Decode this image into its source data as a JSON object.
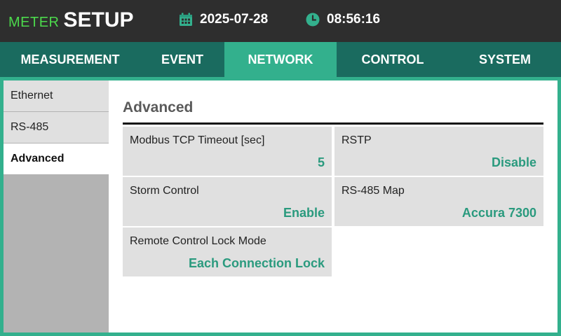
{
  "header": {
    "brand_meter": "METER",
    "brand_setup": "SETUP",
    "date": "2025-07-28",
    "time": "08:56:16",
    "icons": {
      "date": "calendar-icon",
      "time": "clock-icon"
    }
  },
  "tabs": [
    {
      "label": "MEASUREMENT",
      "active": false
    },
    {
      "label": "EVENT",
      "active": false
    },
    {
      "label": "NETWORK",
      "active": true
    },
    {
      "label": "CONTROL",
      "active": false
    },
    {
      "label": "SYSTEM",
      "active": false
    }
  ],
  "sidebar": {
    "items": [
      {
        "label": "Ethernet",
        "active": false
      },
      {
        "label": "RS-485",
        "active": false
      },
      {
        "label": "Advanced",
        "active": true
      }
    ]
  },
  "main": {
    "title": "Advanced",
    "settings": [
      {
        "label": "Modbus TCP Timeout [sec]",
        "value": "5"
      },
      {
        "label": "RSTP",
        "value": "Disable"
      },
      {
        "label": "Storm Control",
        "value": "Enable"
      },
      {
        "label": "RS-485 Map",
        "value": "Accura 7300"
      },
      {
        "label": "Remote Control Lock Mode",
        "value": "Each Connection Lock"
      }
    ]
  },
  "colors": {
    "header_bg": "#2e2e2e",
    "brand_green": "#4cd94c",
    "tab_bg": "#1a6b5f",
    "tab_active": "#33b08d",
    "value_text": "#2a9a7e",
    "cell_bg": "#e0e0e0",
    "sidebar_bg": "#b3b3b3"
  }
}
